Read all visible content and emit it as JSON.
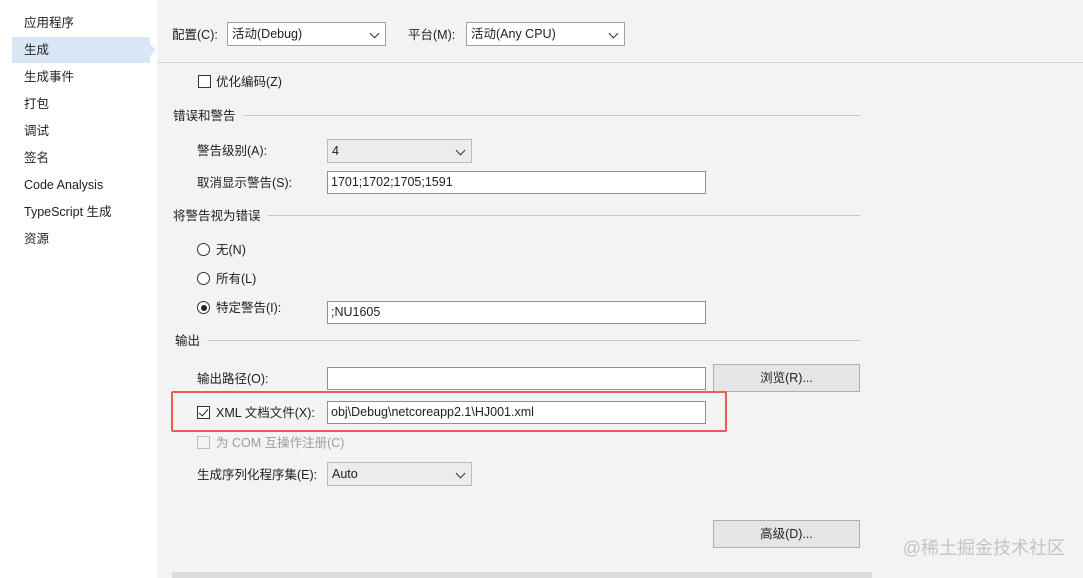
{
  "sidebar": {
    "items": [
      {
        "label": "应用程序"
      },
      {
        "label": "生成"
      },
      {
        "label": "生成事件"
      },
      {
        "label": "打包"
      },
      {
        "label": "调试"
      },
      {
        "label": "签名"
      },
      {
        "label": "Code Analysis"
      },
      {
        "label": "TypeScript 生成"
      },
      {
        "label": "资源"
      }
    ],
    "selected_index": 1
  },
  "header": {
    "config_label": "配置(C):",
    "config_value": "活动(Debug)",
    "platform_label": "平台(M):",
    "platform_value": "活动(Any CPU)"
  },
  "general": {
    "optimize_label": "优化编码(Z)",
    "optimize_checked": false
  },
  "errors_warnings": {
    "title": "错误和警告",
    "warning_level_label": "警告级别(A):",
    "warning_level_value": "4",
    "suppress_label": "取消显示警告(S):",
    "suppress_value": "1701;1702;1705;1591"
  },
  "treat_warnings": {
    "title": "将警告视为错误",
    "none_label": "无(N)",
    "all_label": "所有(L)",
    "specific_label": "特定警告(I):",
    "specific_value": ";NU1605",
    "selected": "specific"
  },
  "output": {
    "title": "输出",
    "path_label": "输出路径(O):",
    "path_value": "",
    "browse_label": "浏览(R)...",
    "xml_label": "XML 文档文件(X):",
    "xml_checked": true,
    "xml_value": "obj\\Debug\\netcoreapp2.1\\HJ001.xml",
    "com_label": "为 COM 互操作注册(C)",
    "com_checked": false,
    "serialization_label": "生成序列化程序集(E):",
    "serialization_value": "Auto",
    "advanced_label": "高级(D)..."
  },
  "watermark": "@稀土掘金技术社区",
  "colors": {
    "sidebar_selected": "#d9e6f5",
    "highlight": "#f05a50",
    "background": "#f3f3f3"
  }
}
